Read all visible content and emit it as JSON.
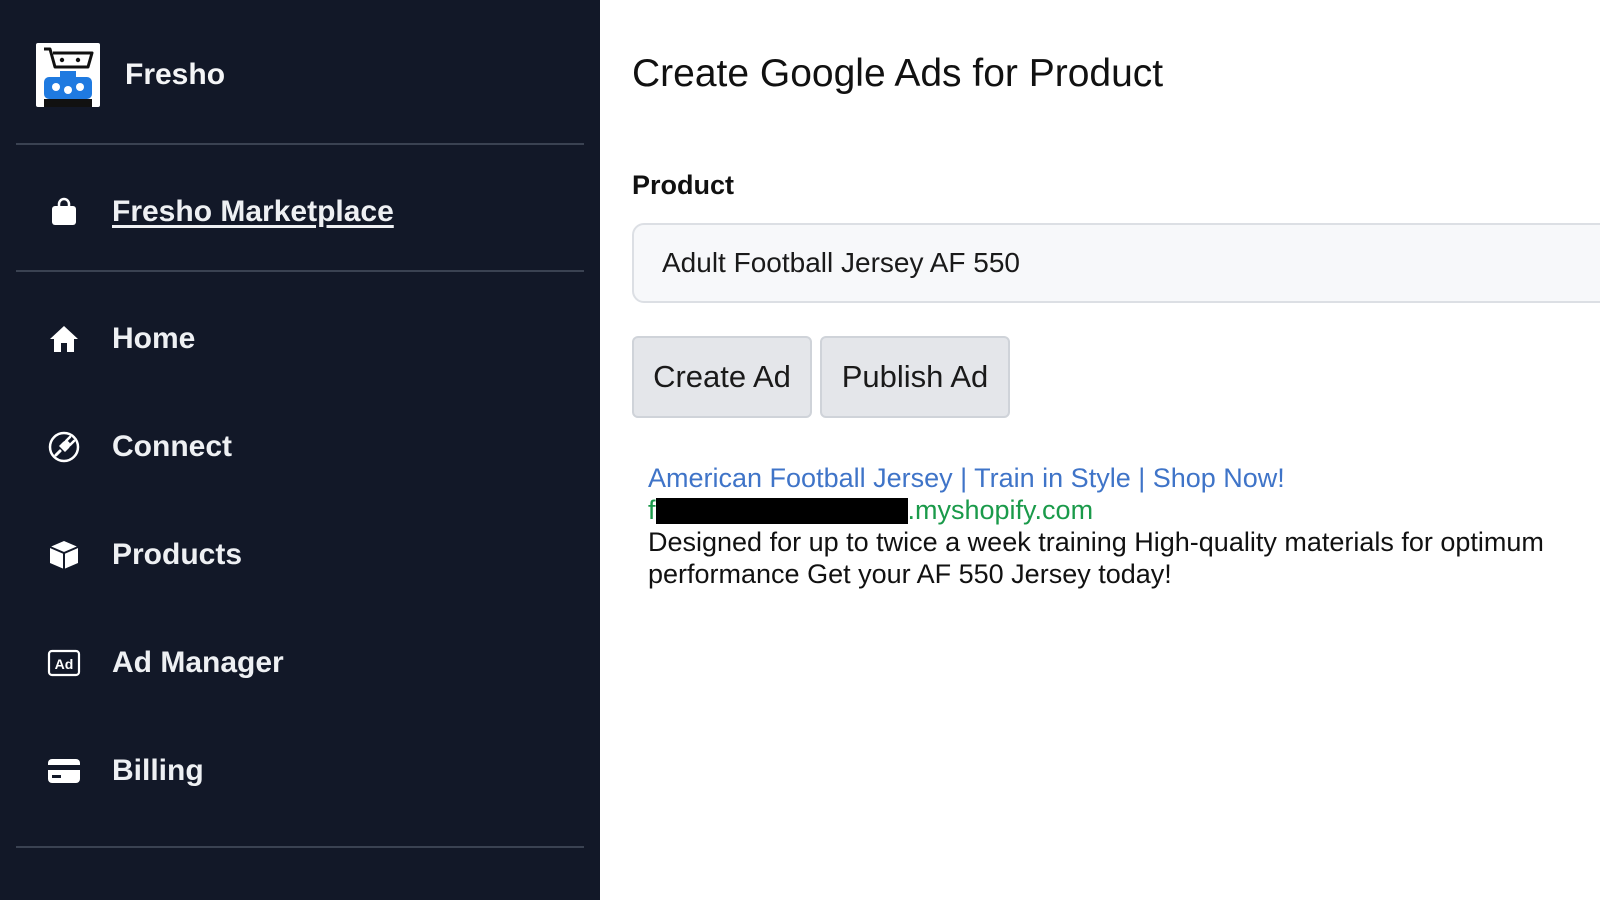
{
  "sidebar": {
    "brand_name": "Fresho",
    "marketplace_link": "Fresho Marketplace",
    "items": [
      {
        "label": "Home",
        "icon": "home-icon"
      },
      {
        "label": "Connect",
        "icon": "plug-icon"
      },
      {
        "label": "Products",
        "icon": "box-icon"
      },
      {
        "label": "Ad Manager",
        "icon": "ad-icon"
      },
      {
        "label": "Billing",
        "icon": "credit-card-icon"
      }
    ],
    "marketplace_icon": "shopping-bag-icon",
    "ad_icon_text": "Ad"
  },
  "main": {
    "title": "Create Google Ads for Product",
    "product_label": "Product",
    "product_value": "Adult Football Jersey AF 550",
    "create_button": "Create Ad",
    "publish_button": "Publish Ad",
    "ad": {
      "headline": "American Football Jersey | Train in Style | Shop Now!",
      "url_prefix": "f",
      "url_suffix": ".myshopify.com",
      "description": "Designed for up to twice a week training High-quality materials for optimum performance Get your AF 550 Jersey today!"
    }
  },
  "colors": {
    "sidebar_bg": "#121828",
    "headline": "#3f74c8",
    "url": "#1a9a4a",
    "logo_accent": "#1f7ae0"
  }
}
